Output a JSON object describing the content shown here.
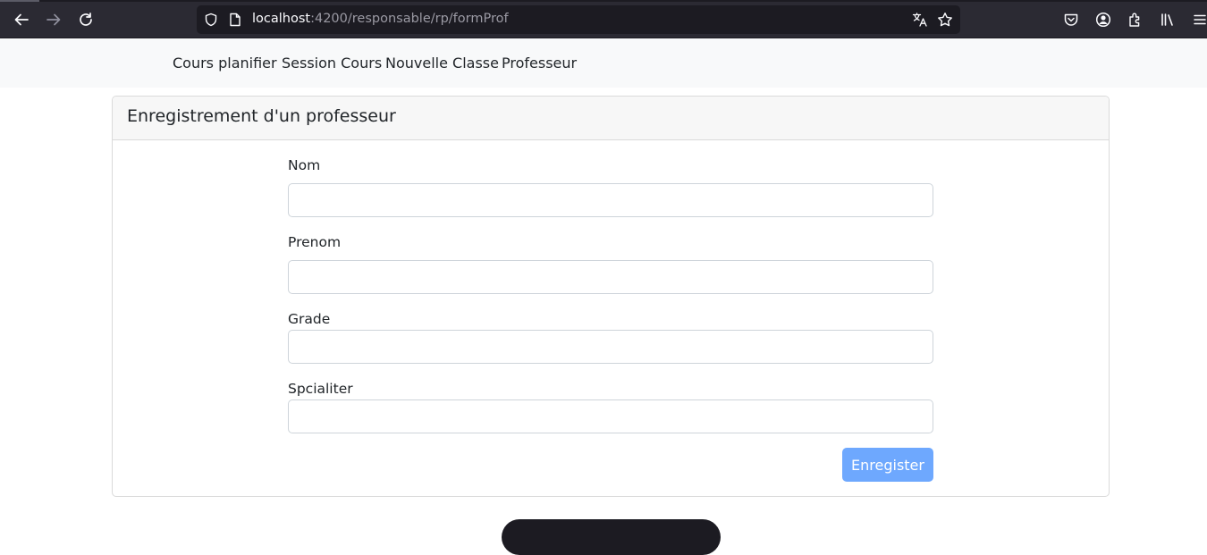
{
  "browser": {
    "url_host": "localhost",
    "url_path": ":4200/responsable/rp/formProf",
    "icons": [
      "back-arrow-icon",
      "forward-arrow-icon",
      "reload-icon",
      "shield-icon",
      "page-icon",
      "translate-icon",
      "star-icon",
      "pocket-icon",
      "account-icon",
      "extensions-icon",
      "library-icon",
      "menu-icon"
    ]
  },
  "navbar": {
    "links": [
      "Cours planifier",
      "Session Cours",
      "Nouvelle Classe",
      "Professeur"
    ]
  },
  "form": {
    "title": "Enregistrement d'un professeur",
    "fields": [
      {
        "label": "Nom",
        "value": ""
      },
      {
        "label": "Prenom",
        "value": ""
      },
      {
        "label": "Grade",
        "value": ""
      },
      {
        "label": "Spcialiter",
        "value": ""
      }
    ],
    "submit_label": "Enregister"
  },
  "colors": {
    "browser_chrome": "#2b2a33",
    "navbar_bg": "#f8f9fa",
    "primary_button": "#6ea8fe"
  }
}
